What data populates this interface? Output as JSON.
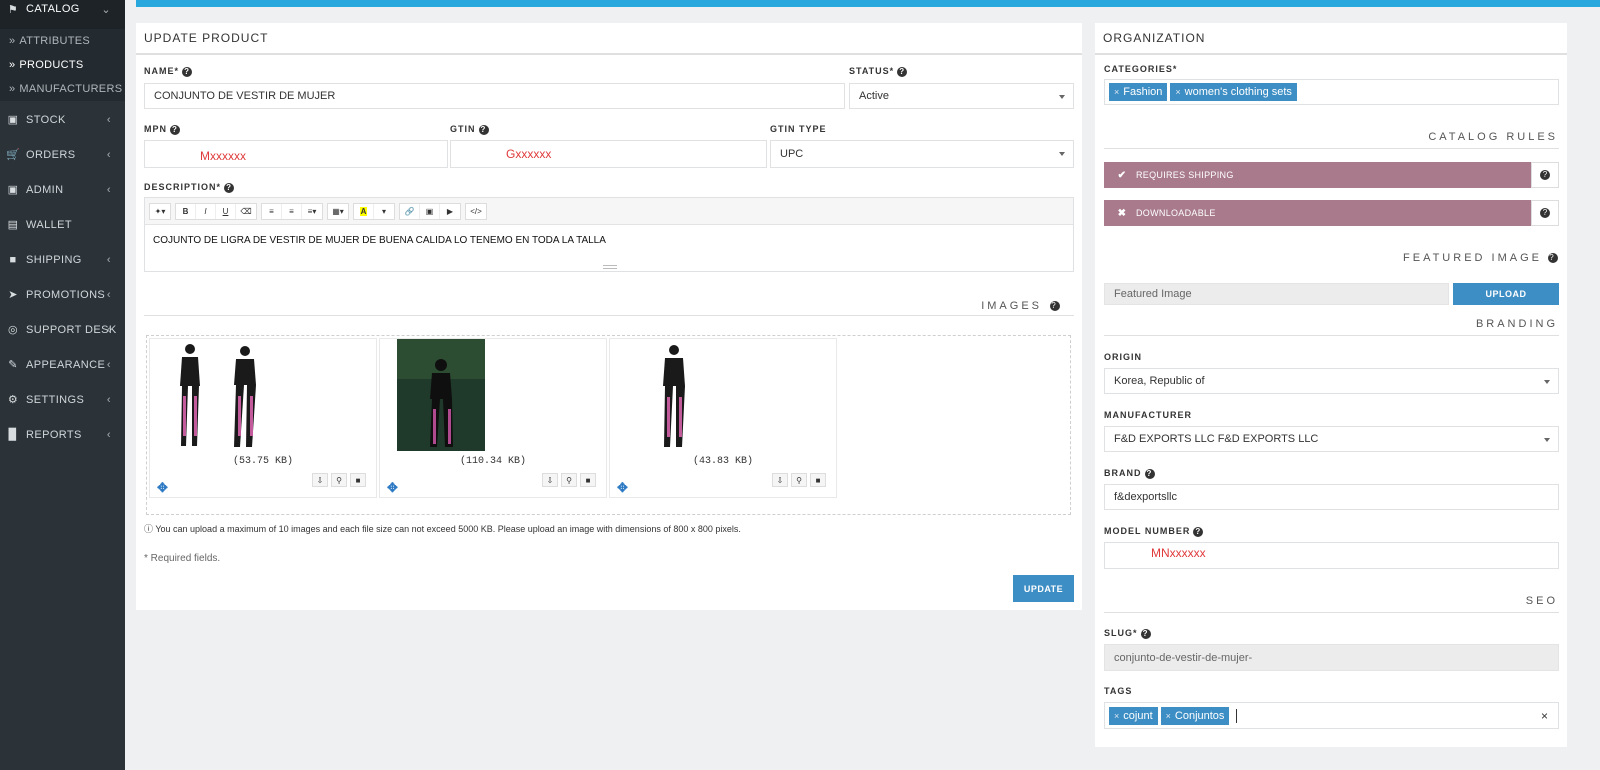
{
  "sidebar": {
    "catalog": "CATALOG",
    "sub": [
      "ATTRIBUTES",
      "PRODUCTS",
      "MANUFACTURERS"
    ],
    "items": [
      "STOCK",
      "ORDERS",
      "ADMIN",
      "WALLET",
      "SHIPPING",
      "PROMOTIONS",
      "SUPPORT DESK",
      "APPEARANCE",
      "SETTINGS",
      "REPORTS"
    ]
  },
  "update": {
    "title": "UPDATE PRODUCT",
    "name_label": "NAME*",
    "name_value": "CONJUNTO DE VESTIR DE MUJER",
    "status_label": "STATUS*",
    "status_value": "Active",
    "mpn_label": "MPN",
    "mpn_value": "Mxxxxxx",
    "gtin_label": "GTIN",
    "gtin_value": "Gxxxxxx",
    "gtin_type_label": "GTIN TYPE",
    "gtin_type_value": "UPC",
    "description_label": "DESCRIPTION*",
    "description_text": "COJUNTO DE LIGRA DE VESTIR DE MUJER DE BUENA CALIDA LO TENEMO EN TODA LA TALLA",
    "images_title": "IMAGES",
    "images": [
      {
        "size": "(53.75 KB)"
      },
      {
        "size": "(110.34 KB)"
      },
      {
        "size": "(43.83 KB)"
      }
    ],
    "upload_note": "You can upload a maximum of 10 images and each file size can not exceed 5000 KB. Please upload an image with dimensions of 800 x 800 pixels.",
    "required_note": "* Required fields.",
    "update_button": "UPDATE"
  },
  "org": {
    "title": "ORGANIZATION",
    "categories_label": "CATEGORIES*",
    "categories": [
      "Fashion",
      "women's clothing sets"
    ],
    "catalog_rules_title": "CATALOG RULES",
    "rule_shipping": "REQUIRES SHIPPING",
    "rule_download": "DOWNLOADABLE",
    "featured_title": "FEATURED IMAGE",
    "featured_placeholder": "Featured Image",
    "upload_button": "UPLOAD",
    "branding_title": "BRANDING",
    "origin_label": "ORIGIN",
    "origin_value": "Korea, Republic of",
    "manufacturer_label": "MANUFACTURER",
    "manufacturer_value": "F&D EXPORTS LLC F&D EXPORTS LLC",
    "brand_label": "BRAND",
    "brand_value": "f&dexportsllc",
    "model_label": "MODEL NUMBER",
    "model_value": "MNxxxxxx",
    "seo_title": "SEO",
    "slug_label": "SLUG*",
    "slug_value": "conjunto-de-vestir-de-mujer-",
    "tags_label": "TAGS",
    "tags": [
      "cojunt",
      "Conjuntos"
    ]
  },
  "colors": {
    "accent": "#3d8ec4",
    "topbar": "#29a8de",
    "sidebar": "#2b3338",
    "rule_bar": "#a87a8c"
  }
}
